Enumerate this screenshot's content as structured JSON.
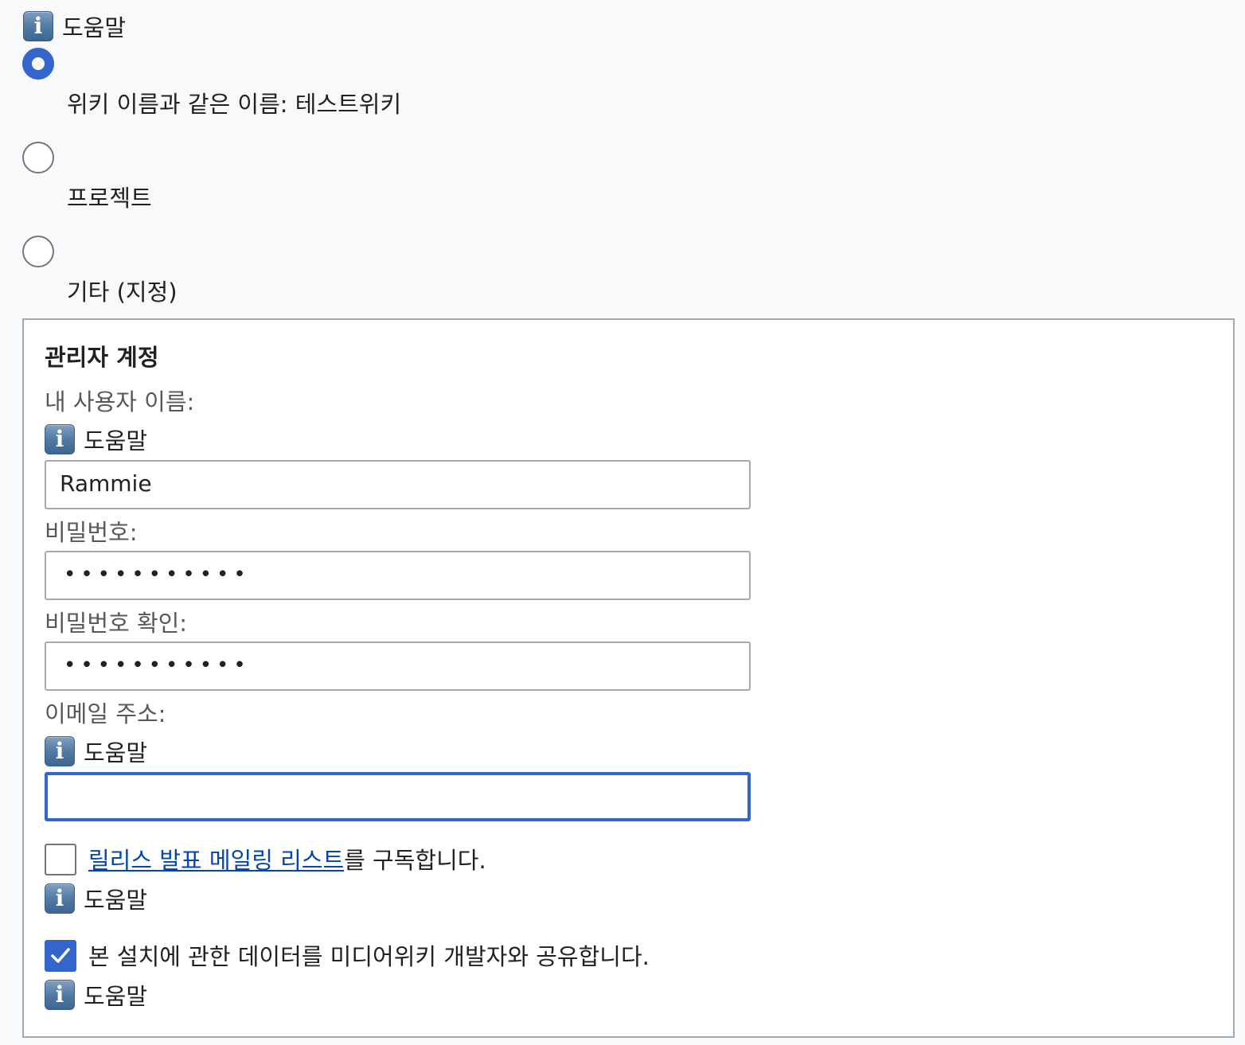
{
  "help_label": "도움말",
  "wiki_name_options": [
    {
      "label": "위키 이름과 같은 이름: 테스트위키",
      "checked": true
    },
    {
      "label": "프로젝트",
      "checked": false
    },
    {
      "label": "기타 (지정)",
      "checked": false
    }
  ],
  "admin": {
    "legend": "관리자 계정",
    "username_label": "내 사용자 이름:",
    "username_value": "Rammie",
    "password_label": "비밀번호:",
    "password_value": "•••••••••••",
    "password_confirm_label": "비밀번호 확인:",
    "password_confirm_value": "•••••••••••",
    "email_label": "이메일 주소:",
    "email_value": "",
    "subscribe_link": "릴리스 발표 메일링 리스트",
    "subscribe_suffix": "를 구독합니다.",
    "subscribe_checked": false,
    "share_label": "본 설치에 관한 데이터를 미디어위키 개발자와 공유합니다.",
    "share_checked": true
  },
  "colors": {
    "accent": "#3366cc",
    "link": "#0645ad",
    "border": "#a2a9b1",
    "background": "#f8f9fa"
  },
  "icons": {
    "help": "info-icon",
    "check": "checkmark-icon"
  }
}
